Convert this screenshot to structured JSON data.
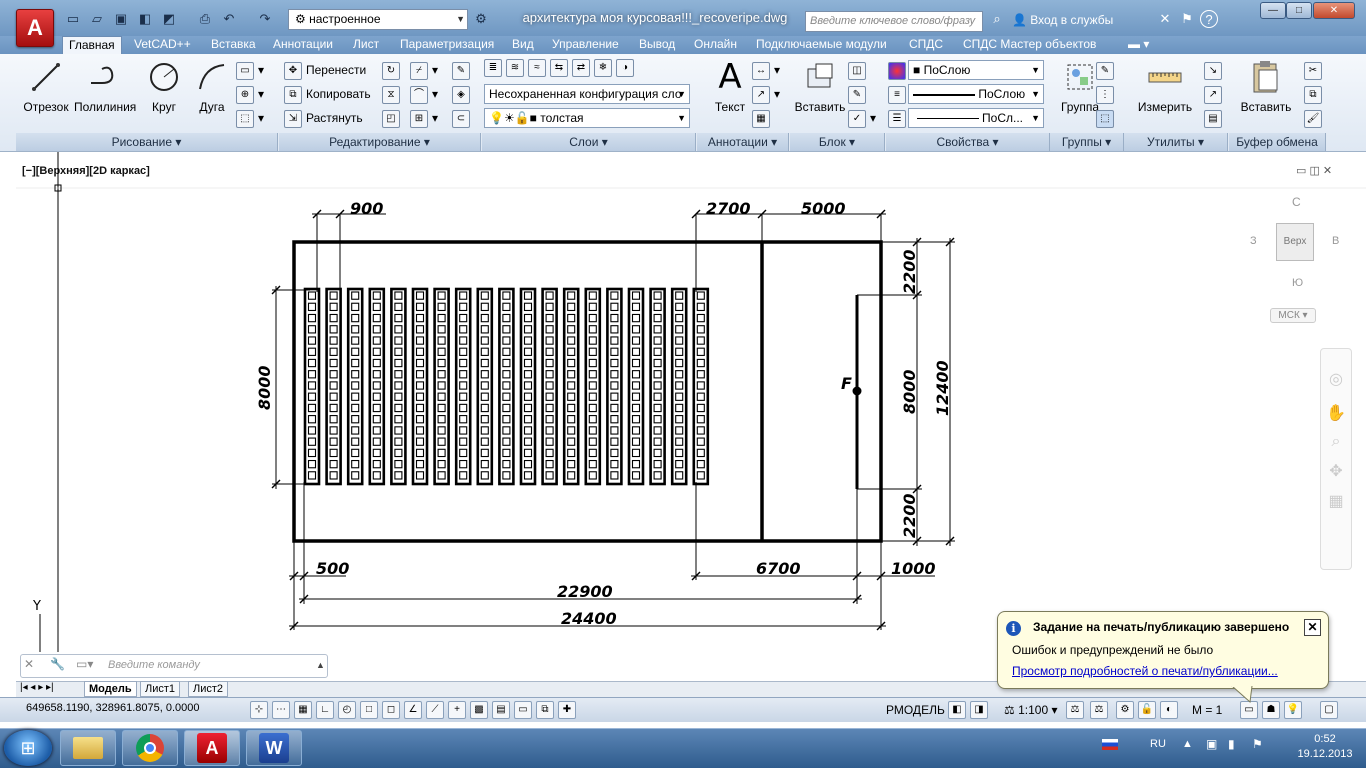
{
  "titlebar": {
    "workspace": "настроенное",
    "document_title": "архитектура моя курсовая!!!_recoveripe.dwg",
    "search_placeholder": "Введите ключевое слово/фразу",
    "login": "Вход в службы"
  },
  "tabs": [
    "Главная",
    "VetCAD++",
    "Вставка",
    "Аннотации",
    "Лист",
    "Параметризация",
    "Вид",
    "Управление",
    "Вывод",
    "Онлайн",
    "Подключаемые модули",
    "СПДС",
    "СПДС Мастер объектов"
  ],
  "active_tab": "Главная",
  "ribbon": {
    "draw": {
      "title": "Рисование",
      "line": "Отрезок",
      "polyline": "Полилиния",
      "circle": "Круг",
      "arc": "Дуга"
    },
    "modify": {
      "title": "Редактирование",
      "move": "Перенести",
      "copy": "Копировать",
      "stretch": "Растянуть"
    },
    "layers": {
      "title": "Слои",
      "config": "Несохраненная конфигурация сло",
      "current": "толстая"
    },
    "annotation": {
      "title": "Аннотации",
      "text": "Текст"
    },
    "block": {
      "title": "Блок",
      "insert": "Вставить"
    },
    "properties": {
      "title": "Свойства",
      "color": "ПоСлою",
      "linetype": "ПоСлою",
      "lineweight": "ПоСл..."
    },
    "groups": {
      "title": "Группы",
      "group": "Группа"
    },
    "utilities": {
      "title": "Утилиты",
      "measure": "Измерить"
    },
    "clipboard": {
      "title": "Буфер обмена",
      "paste": "Вставить"
    }
  },
  "viewport": {
    "label": "[−][Верхняя][2D каркас]"
  },
  "viewcube": {
    "top": "Верх",
    "north": "С",
    "west": "З",
    "east": "В",
    "south": "Ю",
    "wcs": "МСК"
  },
  "drawing": {
    "dims": {
      "d900": "900",
      "d2700": "2700",
      "d5000": "5000",
      "d2200a": "2200",
      "d8000r": "8000",
      "d12400": "12400",
      "d2200b": "2200",
      "d8000l": "8000",
      "d500": "500",
      "d6700": "6700",
      "d1000": "1000",
      "d22900": "22900",
      "d24400": "24400"
    },
    "label_f": "F",
    "seat_columns": 19,
    "seat_rows": 17
  },
  "cmdline": {
    "placeholder": "Введите команду"
  },
  "layout_tabs": [
    "Модель",
    "Лист1",
    "Лист2"
  ],
  "status": {
    "coords": "649658.1190, 328961.8075, 0.0000",
    "model": "РМОДЕЛЬ",
    "scale": "1:100",
    "annot": "M = 1"
  },
  "notification": {
    "title": "Задание на печать/публикацию завершено",
    "body": "Ошибок и предупреждений не было",
    "link": "Просмотр подробностей о печати/публикации..."
  },
  "taskbar": {
    "lang": "RU",
    "time": "0:52",
    "date": "19.12.2013"
  }
}
